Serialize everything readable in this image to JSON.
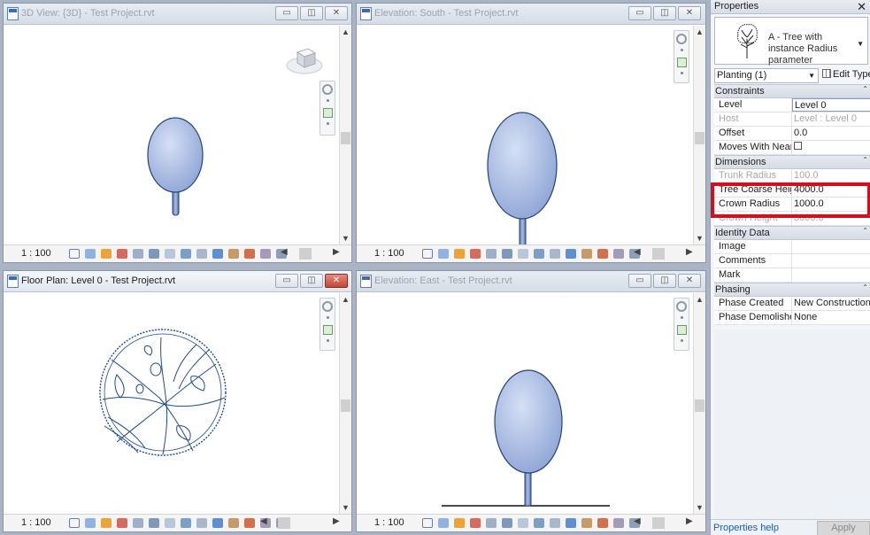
{
  "views": [
    {
      "title": "3D View: {3D} - Test Project.rvt",
      "scale": "1 : 100",
      "active": false
    },
    {
      "title": "Elevation: South - Test Project.rvt",
      "scale": "1 : 100",
      "active": false
    },
    {
      "title": "Floor Plan: Level 0 - Test Project.rvt",
      "scale": "1 : 100",
      "active": true
    },
    {
      "title": "Elevation: East - Test Project.rvt",
      "scale": "1 : 100",
      "active": false
    }
  ],
  "window_buttons": {
    "minimize": "▭",
    "restore": "◫",
    "close": "✕"
  },
  "icons": {
    "view_type": "revit-view-icon",
    "viewcube": "viewcube-icon",
    "steering_wheel": "steering-wheel-icon",
    "zoom": "zoom-icon",
    "statusbar": [
      "detail-level-icon",
      "visual-style-icon",
      "sun-path-icon",
      "shadows-icon",
      "render-icon",
      "crop-icon",
      "show-crop-icon",
      "unlock-3d-icon",
      "temp-hide-icon",
      "reveal-hidden-icon",
      "worksharing-icon",
      "analysis-icon",
      "highlight-icon",
      "constraints-icon"
    ]
  },
  "colors": {
    "tree_fill": "#b4c4e6",
    "tree_stroke": "#24447a",
    "highlight": "#d0101c",
    "link": "#1a5fb4"
  },
  "properties": {
    "title": "Properties",
    "close": "✕",
    "type_name": "A - Tree with instance Radius parameter",
    "filter": "Planting (1)",
    "edit_type": "Edit Type",
    "groups": [
      {
        "name": "Constraints",
        "rows": [
          {
            "key": "Level",
            "value": "Level 0",
            "disabled": false,
            "editing": true
          },
          {
            "key": "Host",
            "value": "Level : Level 0",
            "disabled": true
          },
          {
            "key": "Offset",
            "value": "0.0",
            "disabled": false
          },
          {
            "key": "Moves With Near...",
            "value": "",
            "disabled": false,
            "checkbox": true
          }
        ]
      },
      {
        "name": "Dimensions",
        "rows": [
          {
            "key": "Trunk Radius",
            "value": "100.0",
            "disabled": true
          },
          {
            "key": "Tree Coarse Height",
            "value": "4000.0",
            "disabled": false
          },
          {
            "key": "Crown Radius",
            "value": "1000.0",
            "disabled": false
          },
          {
            "key": "Crown Height",
            "value": "3000.0",
            "disabled": true
          }
        ]
      },
      {
        "name": "Identity Data",
        "rows": [
          {
            "key": "Image",
            "value": "",
            "disabled": false
          },
          {
            "key": "Comments",
            "value": "",
            "disabled": false
          },
          {
            "key": "Mark",
            "value": "",
            "disabled": false
          }
        ]
      },
      {
        "name": "Phasing",
        "rows": [
          {
            "key": "Phase Created",
            "value": "New Construction",
            "disabled": false
          },
          {
            "key": "Phase Demolished",
            "value": "None",
            "disabled": false
          }
        ]
      }
    ],
    "help_link": "Properties help",
    "apply": "Apply"
  }
}
